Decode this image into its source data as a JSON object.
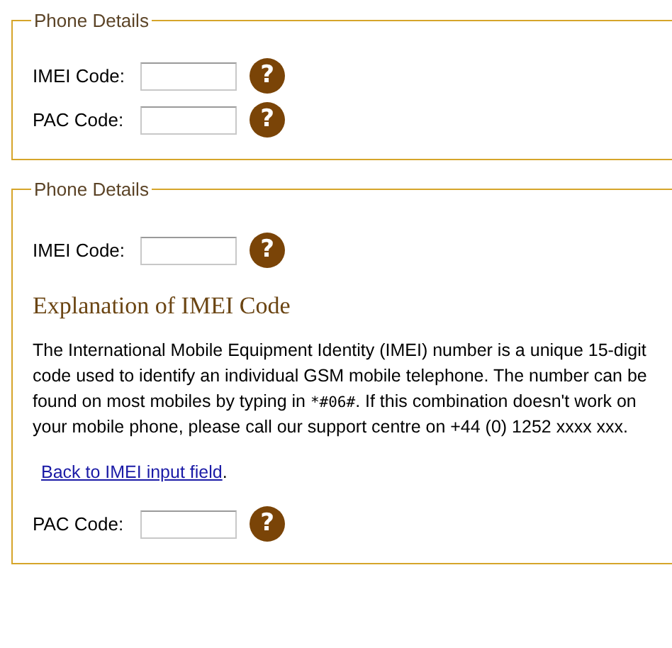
{
  "sections": [
    {
      "legend": "Phone Details",
      "items": [
        {
          "kind": "field",
          "label": "IMEI Code:",
          "help": "?"
        },
        {
          "kind": "field",
          "label": "PAC Code:",
          "help": "?"
        }
      ]
    },
    {
      "legend": "Phone Details",
      "items": [
        {
          "kind": "field",
          "label": "IMEI Code:",
          "help": "?"
        },
        {
          "kind": "explanation",
          "heading": "Explanation of IMEI Code",
          "text_before": "The International Mobile Equipment Identity (IMEI) number is a unique 15-digit code used to identify an individual GSM mobile telephone. The number can be found on most mobiles by typing in ",
          "code": "*#06#",
          "text_after": ". If this combination doesn't work on your mobile phone, please call our support centre on +44 (0) 1252 xxxx xxx.",
          "link": "Back to IMEI input field",
          "link_after": "."
        },
        {
          "kind": "field",
          "label": "PAC Code:",
          "help": "?"
        }
      ]
    }
  ]
}
